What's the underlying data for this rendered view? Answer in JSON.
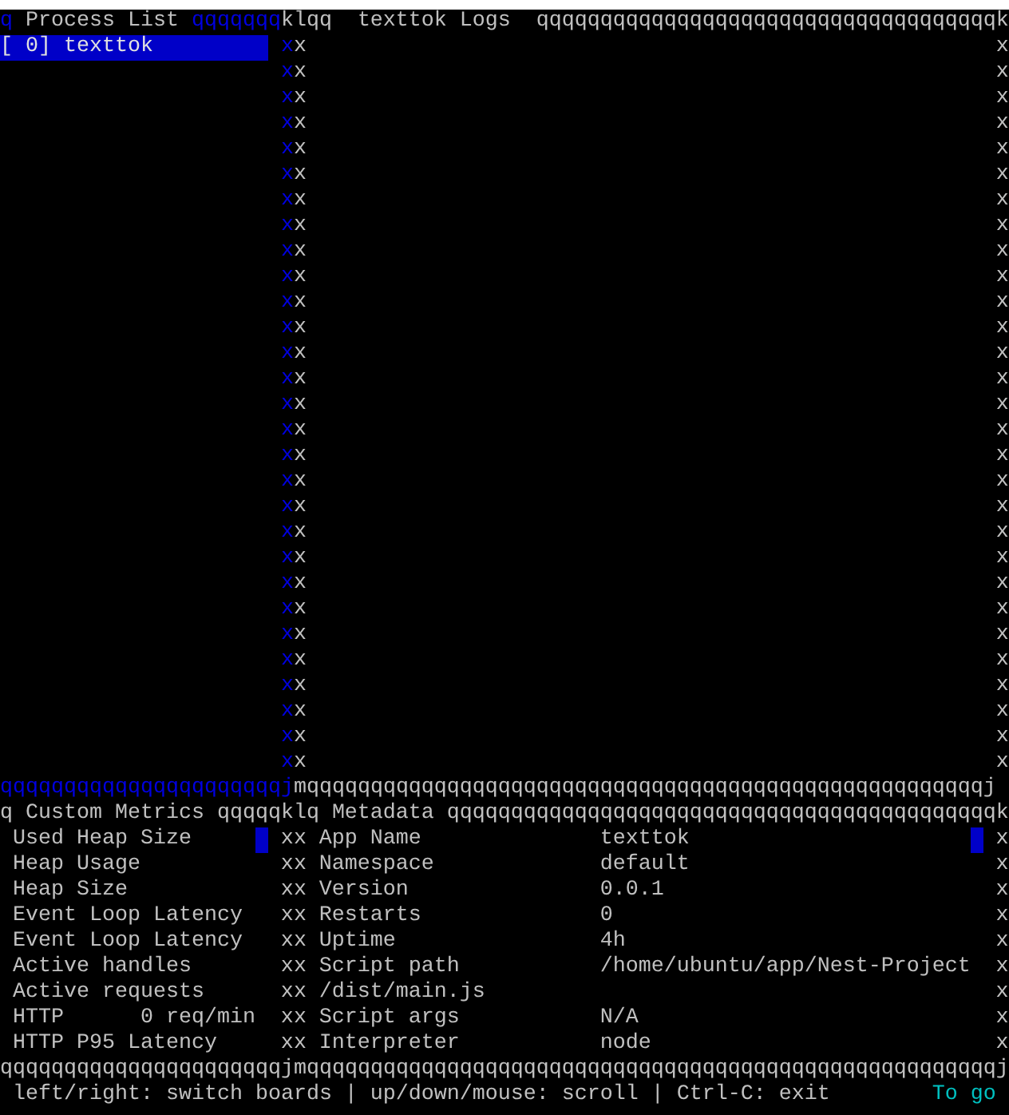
{
  "process_list": {
    "title_row": {
      "lead": "q",
      "title": "Process List",
      "fill": "qqqqqqq",
      "corner": "k"
    },
    "processes": [
      {
        "label": "[ 0] texttok",
        "selected": true
      }
    ],
    "edge": "xxxxxxxxxxxxxxxxxxxxxxxxxxxxx",
    "bottom": "qqqqqqqqqqqqqqqqqqqqqqj"
  },
  "logs": {
    "title_row": {
      "lead": "lqq",
      "title": "texttok Logs",
      "fill": "qqqqqqqqqqqqqqqqqqqqqqqqqqqqqqqqqqqq",
      "corner": "k"
    },
    "left_edge": "xxxxxxxxxxxxxxxxxxxxxxxxxxxxx",
    "right_edge": "xxxxxxxxxxxxxxxxxxxxxxxxxxxxx",
    "bottom": "mqqqqqqqqqqqqqqqqqqqqqqqqqqqqqqqqqqqqqqqqqqqqqqqqqqqqqj"
  },
  "custom_metrics": {
    "title_row": {
      "lead": "q",
      "title": "Custom Metrics",
      "fill": "qqqqq",
      "corner": "k"
    },
    "items": [
      {
        "label": "Used Heap Size"
      },
      {
        "label": "Heap Usage"
      },
      {
        "label": "Heap Size"
      },
      {
        "label": "Event Loop Latency"
      },
      {
        "label": "Event Loop Latency"
      },
      {
        "label": "Active handles"
      },
      {
        "label": "Active requests"
      },
      {
        "label": "HTTP",
        "value": "0 req/min"
      },
      {
        "label": "HTTP P95 Latency"
      }
    ],
    "edge": "xxxxxxxxx",
    "bottom": "qqqqqqqqqqqqqqqqqqqqqqj"
  },
  "metadata": {
    "title_row": {
      "lead": "lq",
      "title": "Metadata",
      "fill": "qqqqqqqqqqqqqqqqqqqqqqqqqqqqqqqqqqqqqqqqqqq",
      "corner": "k"
    },
    "items": [
      {
        "key": "App Name",
        "value": "texttok"
      },
      {
        "key": "Namespace",
        "value": "default"
      },
      {
        "key": "Version",
        "value": "0.0.1"
      },
      {
        "key": "Restarts",
        "value": "0"
      },
      {
        "key": "Uptime",
        "value": "4h"
      },
      {
        "key": "Script path",
        "value": "/home/ubuntu/app/Nest-Project"
      },
      {
        "key": "/dist/main.js"
      },
      {
        "key": "Script args",
        "value": "N/A"
      },
      {
        "key": "Interpreter",
        "value": "node"
      }
    ],
    "left_edge": "xxxxxxxxx",
    "right_edge": "xxxxxxxxx",
    "bottom": "mqqqqqqqqqqqqqqqqqqqqqqqqqqqqqqqqqqqqqqqqqqqqqqqqqqqqqqj"
  },
  "help_bar": {
    "text": "left/right: switch boards | up/down/mouse: scroll | Ctrl-C: exit",
    "hint": "To go"
  }
}
